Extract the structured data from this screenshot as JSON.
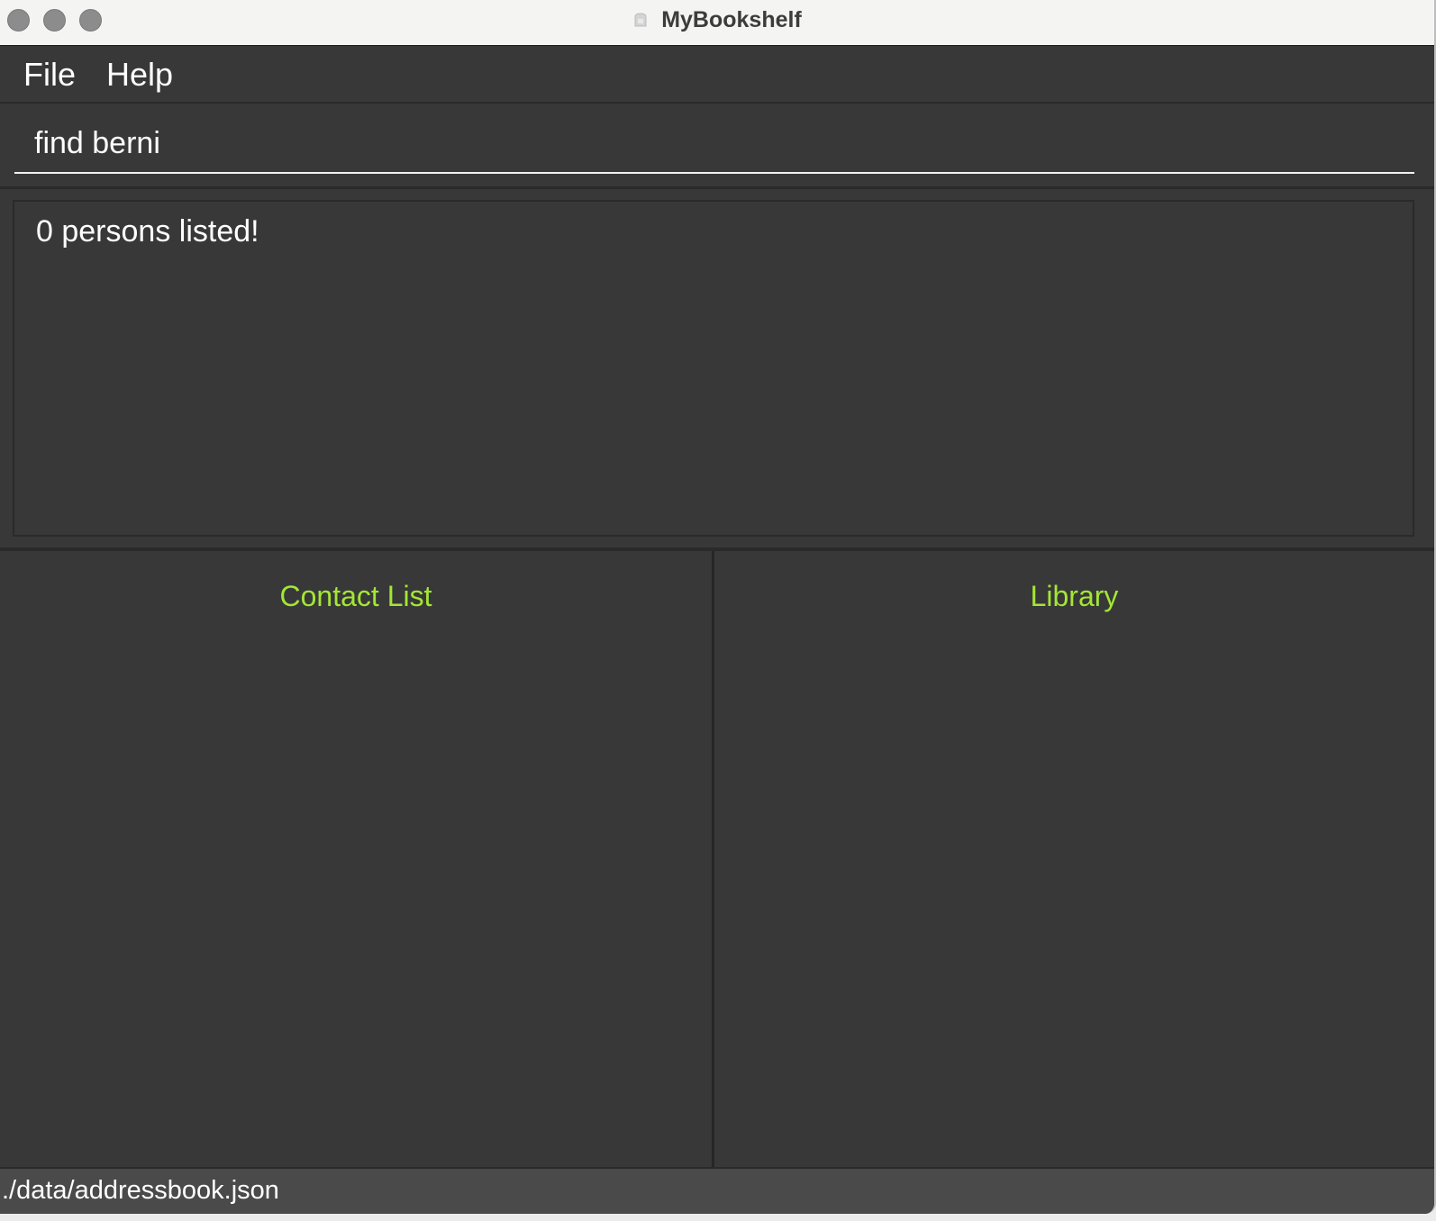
{
  "window": {
    "title": "MyBookshelf"
  },
  "menu": {
    "items": [
      {
        "label": "File"
      },
      {
        "label": "Help"
      }
    ]
  },
  "command": {
    "value": "find berni"
  },
  "result": {
    "message": "0 persons listed!"
  },
  "panels": {
    "left_title": "Contact List",
    "right_title": "Library"
  },
  "status": {
    "file_path": "./data/addressbook.json"
  },
  "colors": {
    "background": "#383838",
    "accent_title": "#a3e635",
    "text": "#ffffff",
    "titlebar": "#f4f4f2"
  }
}
